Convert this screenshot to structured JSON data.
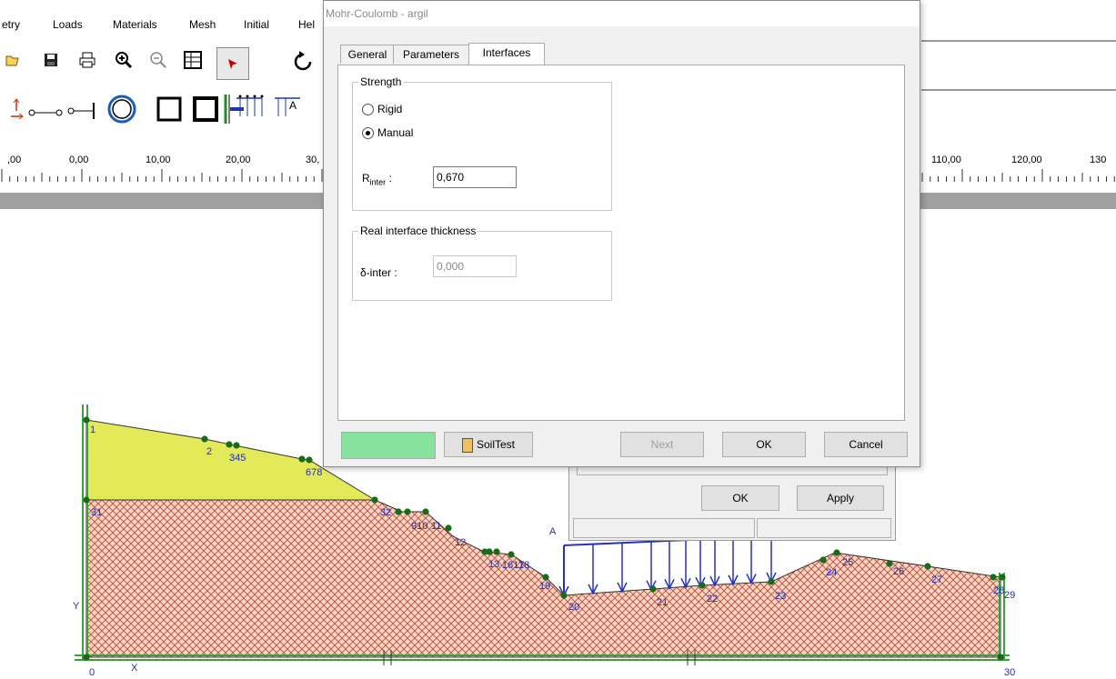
{
  "menu": {
    "items": [
      "etry",
      "Loads",
      "Materials",
      "Mesh",
      "Initial",
      "Hel"
    ]
  },
  "ruler": {
    "labels": [
      ",00",
      "0,00",
      "10,00",
      "20,00",
      "30,",
      "110,00",
      "120,00",
      "130"
    ]
  },
  "dialog": {
    "title": "Mohr-Coulomb - argil",
    "tabs": [
      "General",
      "Parameters",
      "Interfaces"
    ],
    "active_tab": "Interfaces",
    "strength": {
      "legend": "Strength",
      "rigid_label": "Rigid",
      "manual_label": "Manual",
      "selected": "Manual",
      "rinter_label_main": "R",
      "rinter_label_sub": "inter",
      "rinter_colon": ":",
      "rinter_value": "0,670"
    },
    "thickness": {
      "legend": "Real interface thickness",
      "label": "δ-inter :",
      "value": "0,000"
    },
    "color_swatch": "#86e29c",
    "buttons": {
      "soiltest": "SoilTest",
      "next": "Next",
      "ok": "OK",
      "cancel": "Cancel"
    }
  },
  "second_dialog": {
    "ok": "OK",
    "apply": "Apply"
  },
  "geometry": {
    "point_labels": [
      "1",
      "2",
      "345",
      "678",
      "31",
      "32",
      "910",
      "11",
      "12",
      "13",
      "1617",
      "18",
      "19",
      "20",
      "21",
      "22",
      "23",
      "24",
      "25",
      "26",
      "27",
      "28",
      "29",
      "0",
      "30"
    ],
    "axis_x": "X",
    "axis_y": "Y",
    "load_label": "A"
  },
  "colors": {
    "soil_upper": "#e2ea5a",
    "soil_lower": "#f0c4b8",
    "hatch": "#b85030",
    "load": "#2230c8",
    "node": "#1a6a1a"
  }
}
